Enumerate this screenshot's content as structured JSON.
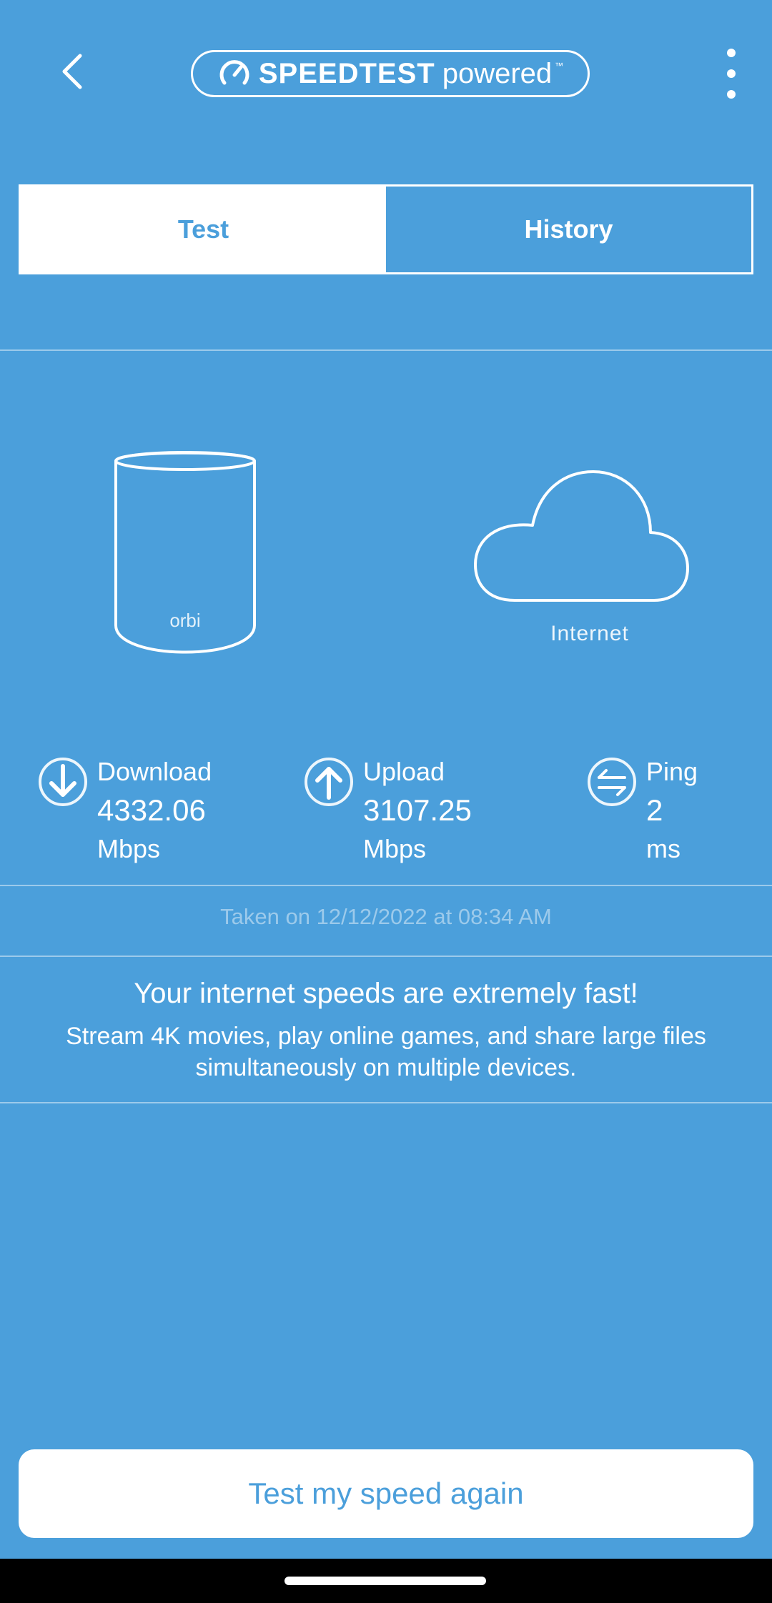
{
  "header": {
    "logo_brand": "SPEEDTEST",
    "logo_powered": "powered",
    "logo_tm": "™",
    "icons": {
      "back": "chevron-left-icon",
      "menu": "more-vert-icon",
      "logo": "speedometer-icon"
    }
  },
  "tabs": [
    {
      "label": "Test",
      "active": true
    },
    {
      "label": "History",
      "active": false
    }
  ],
  "devices": {
    "router_brand": "orbi",
    "internet_label": "Internet"
  },
  "stats": {
    "download": {
      "label": "Download",
      "value": "4332.06",
      "unit": "Mbps",
      "icon": "arrow-down-circle-icon"
    },
    "upload": {
      "label": "Upload",
      "value": "3107.25",
      "unit": "Mbps",
      "icon": "arrow-up-circle-icon"
    },
    "ping": {
      "label": "Ping",
      "value": "2",
      "unit": "ms",
      "icon": "swap-arrows-circle-icon"
    }
  },
  "taken_on": "Taken on 12/12/2022 at 08:34 AM",
  "result": {
    "title": "Your internet speeds are extremely fast!",
    "description": "Stream 4K movies, play online games, and share large files simultaneously on multiple devices."
  },
  "retest_button": "Test my speed again",
  "colors": {
    "background": "#4b9fdb",
    "foreground": "#ffffff",
    "muted_text": "#a4cced",
    "navbar": "#000000"
  }
}
